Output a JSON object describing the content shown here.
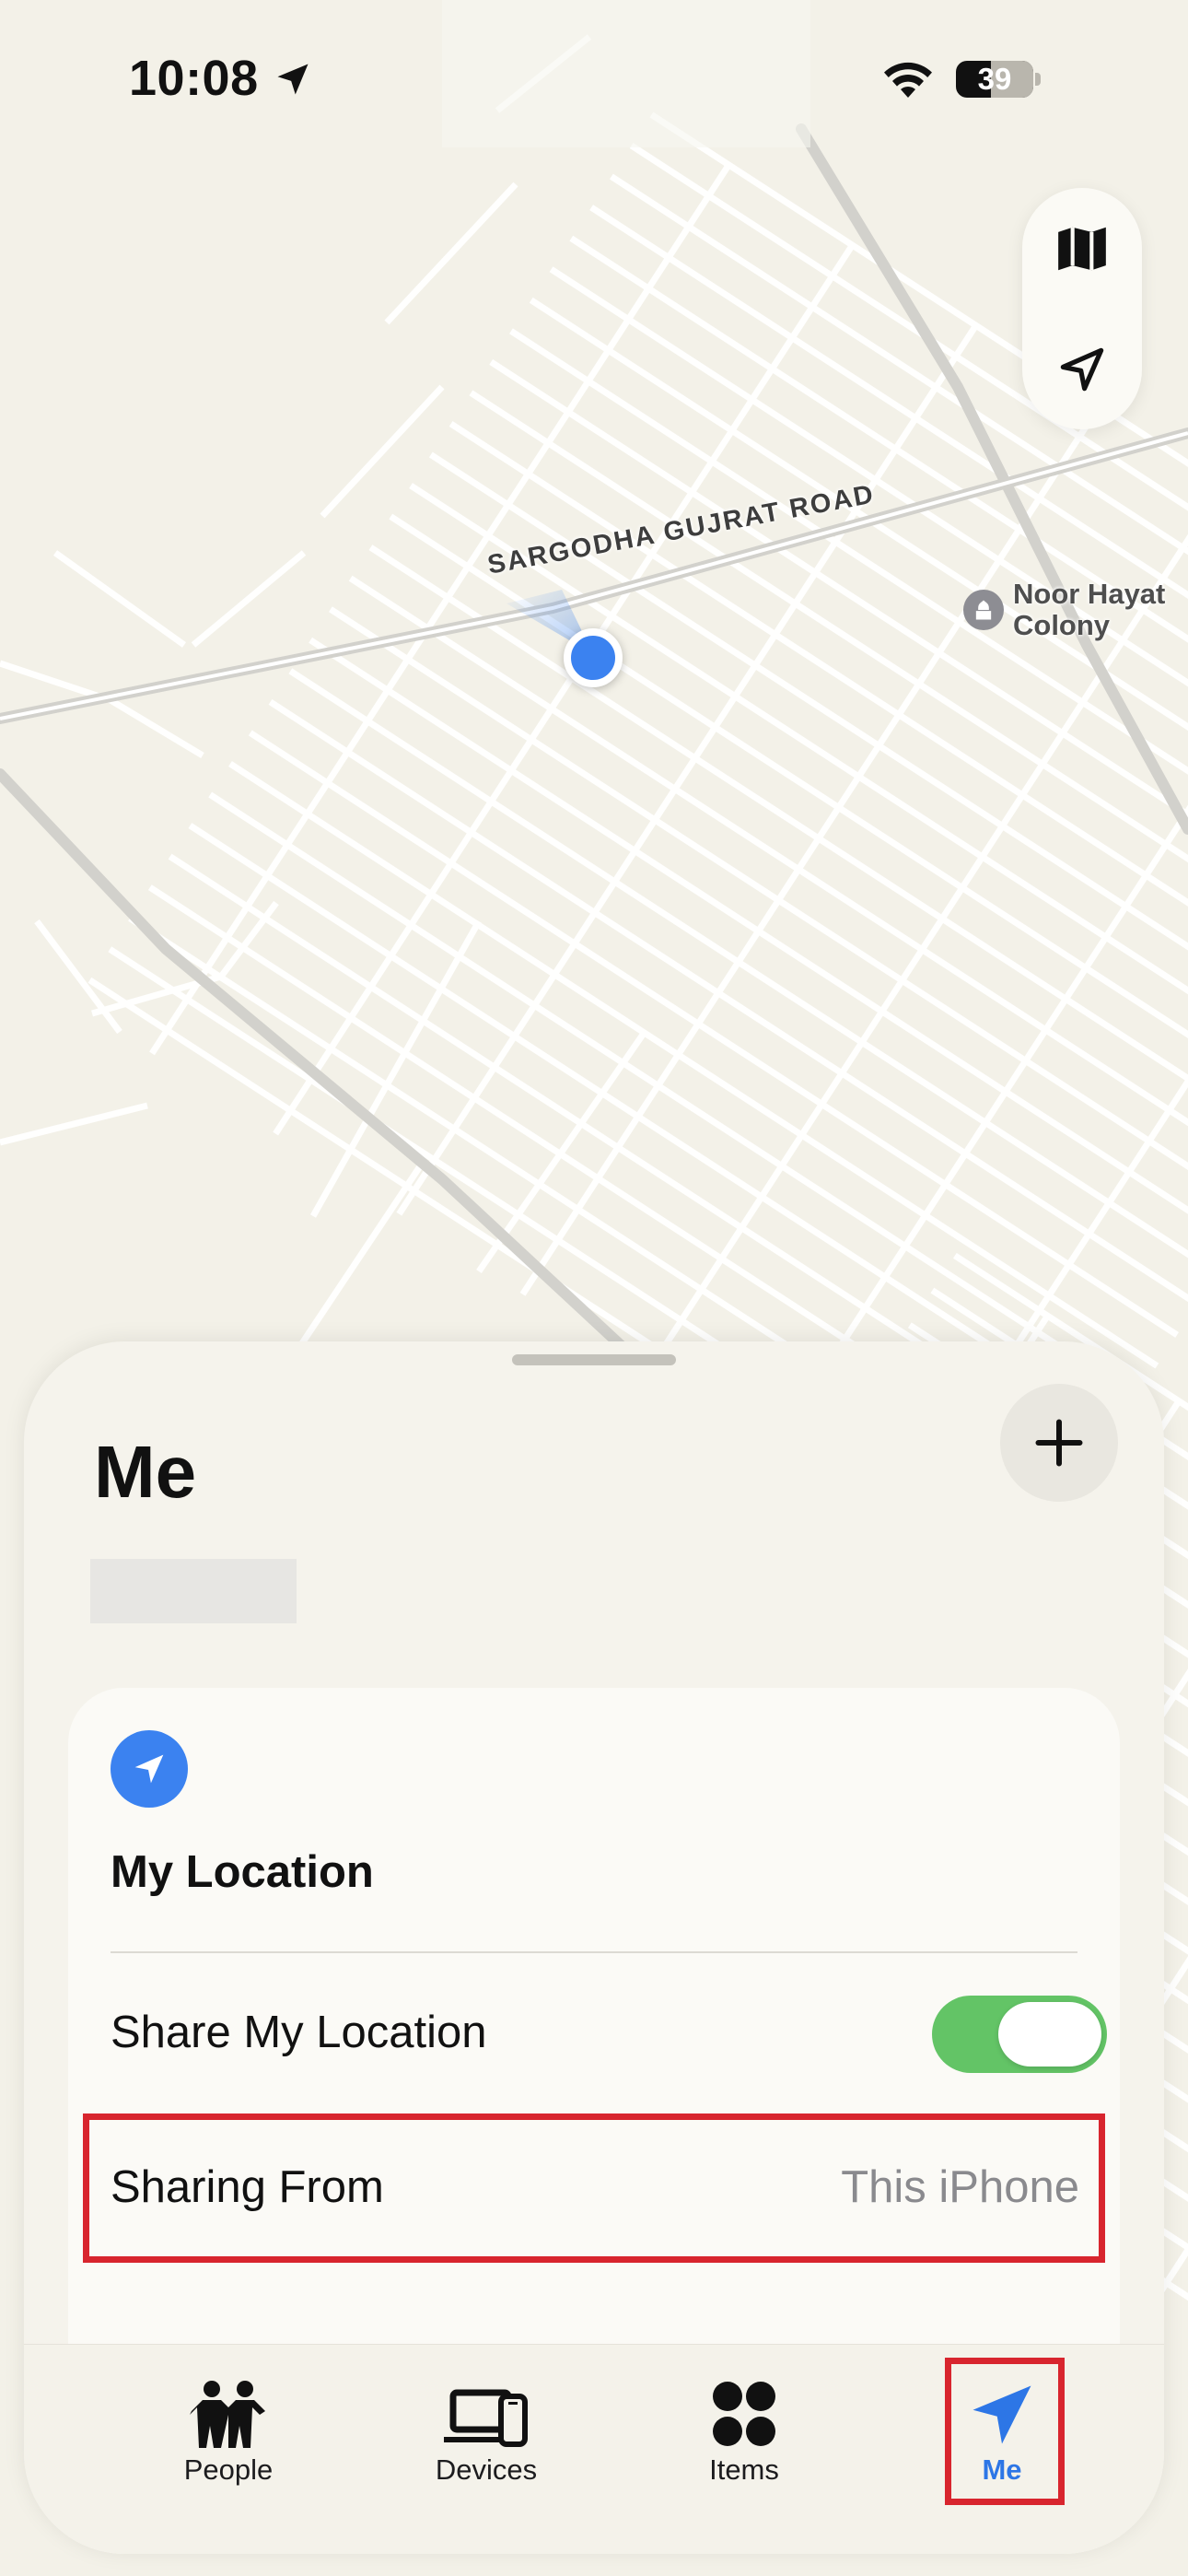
{
  "status_bar": {
    "time": "10:08",
    "battery": "39"
  },
  "map": {
    "road_label": "SARGODHA GUJRAT ROAD",
    "poi_name_line1": "Noor Hayat",
    "poi_name_line2": "Colony",
    "icons": {
      "map_mode": "map-icon",
      "locate": "location-arrow-icon",
      "poi": "mosque-icon"
    }
  },
  "sheet": {
    "title": "Me",
    "add_icon": "plus-icon",
    "card": {
      "title": "My Location",
      "share_label": "Share My Location",
      "share_enabled": true,
      "sharing_from_label": "Sharing From",
      "sharing_from_value": "This iPhone"
    }
  },
  "tab_bar": {
    "tabs": [
      {
        "label": "People",
        "icon": "people-icon",
        "active": false
      },
      {
        "label": "Devices",
        "icon": "devices-icon",
        "active": false
      },
      {
        "label": "Items",
        "icon": "items-icon",
        "active": false
      },
      {
        "label": "Me",
        "icon": "location-arrow-icon",
        "active": true
      }
    ]
  },
  "colors": {
    "accent_blue": "#3b82f0",
    "toggle_green": "#63c466",
    "highlight_red": "#d8252e"
  }
}
